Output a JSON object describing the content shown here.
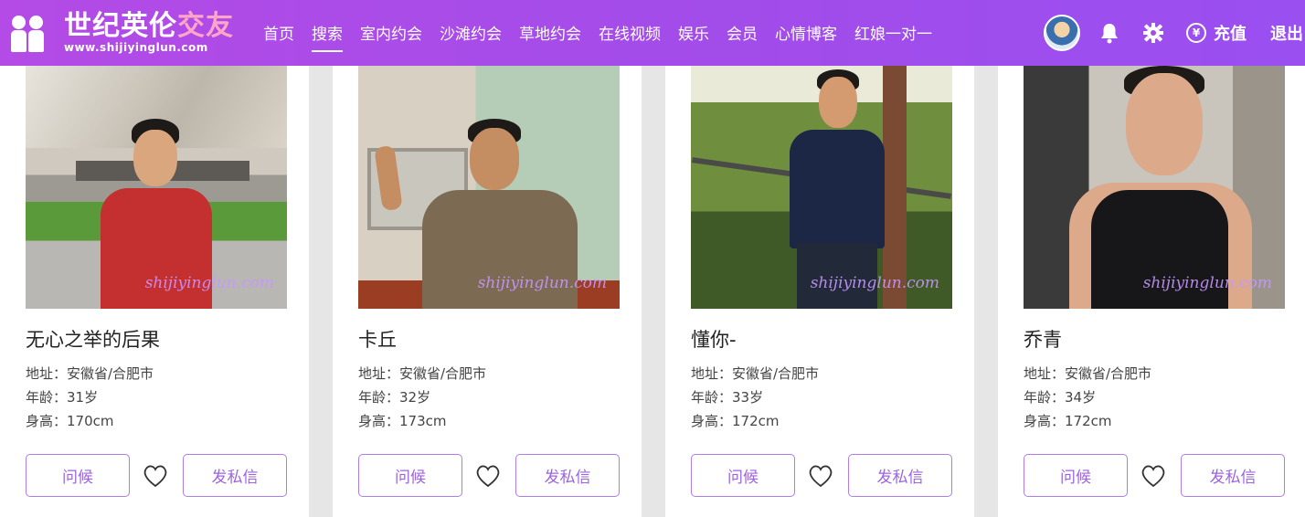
{
  "header": {
    "logo_title_a": "世纪英伦",
    "logo_title_b": "交友",
    "logo_url": "www.shijiyinglun.com",
    "nav": [
      "首页",
      "搜索",
      "室内约会",
      "沙滩约会",
      "草地约会",
      "在线视频",
      "娱乐",
      "会员",
      "心情博客",
      "红娘一对一"
    ],
    "active_nav": "搜索",
    "recharge_label": "充值",
    "recharge_symbol": "¥",
    "logout_label": "退出"
  },
  "watermark": "shijiyinglun.com",
  "buttons": {
    "greet": "问候",
    "message": "发私信"
  },
  "profiles": [
    {
      "name": "无心之举的后果",
      "address": "地址：安徽省/合肥市",
      "age": "年龄：31岁",
      "height": "身高：170cm"
    },
    {
      "name": "卡丘",
      "address": "地址：安徽省/合肥市",
      "age": "年龄：32岁",
      "height": "身高：173cm"
    },
    {
      "name": "懂你-",
      "address": "地址：安徽省/合肥市",
      "age": "年龄：33岁",
      "height": "身高：172cm"
    },
    {
      "name": "乔青",
      "address": "地址：安徽省/合肥市",
      "age": "年龄：34岁",
      "height": "身高：172cm"
    }
  ],
  "colors": {
    "header": "#a24cea",
    "button_border": "#b07ce8",
    "button_text": "#9c64e0"
  }
}
